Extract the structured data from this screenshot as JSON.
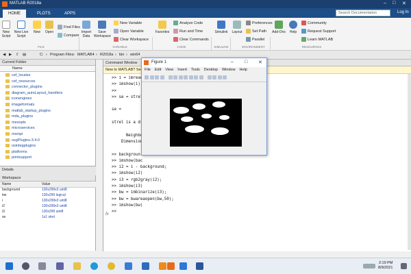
{
  "window": {
    "title": "MATLAB R2018a"
  },
  "tabs": [
    {
      "label": "HOME"
    },
    {
      "label": "PLOTS"
    },
    {
      "label": "APPS"
    }
  ],
  "search": {
    "placeholder": "Search Documentation"
  },
  "login": "Log In",
  "ribbon": {
    "new_script": "New Script",
    "new_live_script": "New Live Script",
    "new": "New",
    "open": "Open",
    "find_files": "Find Files",
    "compare": "Compare",
    "import_data": "Import Data",
    "save_workspace": "Save Workspace",
    "new_variable": "New Variable",
    "open_variable": "Open Variable",
    "clear_workspace": "Clear Workspace",
    "favorites": "Favorites",
    "analyze_code": "Analyze Code",
    "run_and_time": "Run and Time",
    "clear_commands": "Clear Commands",
    "simulink": "Simulink",
    "layout": "Layout",
    "preferences": "Preferences",
    "set_path": "Set Path",
    "parallel": "Parallel",
    "add_ons": "Add-Ons",
    "help": "Help",
    "community": "Community",
    "request_support": "Request Support",
    "learn_matlab": "Learn MATLAB",
    "sections": {
      "file": "FILE",
      "variable": "VARIABLE",
      "code": "CODE",
      "simulink": "SIMULINK",
      "environment": "ENVIRONMENT",
      "resources": "RESOURCES"
    }
  },
  "path": [
    "C:",
    "Program Files",
    "MATLAB4",
    "R2018a",
    "bin",
    "win64"
  ],
  "current_folder": {
    "title": "Current Folder",
    "column": "Name",
    "items": [
      "cef_locales",
      "cef_resources",
      "connector_plugins",
      "diagram_autoLayout_handlers",
      "iconengines",
      "imageformats",
      "matlab_startup_plugins",
      "mda_plugins",
      "mexopts",
      "microservices",
      "msmpi",
      "osgPlugins-3.4.0",
      "osintegplugins",
      "platforms",
      "printsupport"
    ]
  },
  "details": {
    "label": "Details"
  },
  "workspace": {
    "title": "Workspace",
    "columns": [
      "Name",
      "Value"
    ],
    "rows": [
      {
        "name": "background",
        "value": "130x299x3 uint8"
      },
      {
        "name": "bw",
        "value": "130x299 logical"
      },
      {
        "name": "i",
        "value": "130x299x3 uint8"
      },
      {
        "name": "i2",
        "value": "130x299x3 uint8"
      },
      {
        "name": "i3",
        "value": "130x299 uint8"
      },
      {
        "name": "se",
        "value": "1x1 strel"
      }
    ]
  },
  "command_window": {
    "title": "Command Window",
    "banner": "New to MATLAB? See",
    "lines": [
      ">> i = imread",
      ">> imshow(i)",
      ">>",
      ">> se = strel",
      "",
      "se =",
      "",
      "strel is a di",
      "",
      "      Neighbo",
      "    Dimension",
      "",
      ">> backgroun",
      ">> imshow(bac",
      ">> i2 = i - background;",
      ">> imshow(i2)",
      ">> i3 = rgb2gray(i2);",
      ">> imshow(i3)",
      ">> bw = imbinarize(i3);",
      ">> bw = bwareaopen(bw,50);",
      ">> imshow(bw)",
      ">>"
    ],
    "fx": "fx"
  },
  "figure": {
    "title": "Figure 1",
    "menu": [
      "File",
      "Edit",
      "View",
      "Insert",
      "Tools",
      "Desktop",
      "Window",
      "Help"
    ]
  },
  "clock": {
    "time": "2:19 PM",
    "date": "8/9/2021"
  },
  "colors": {
    "titlebar": "#1b3f6e",
    "tabrow": "#1e4e87",
    "accent": "#2244aa"
  }
}
